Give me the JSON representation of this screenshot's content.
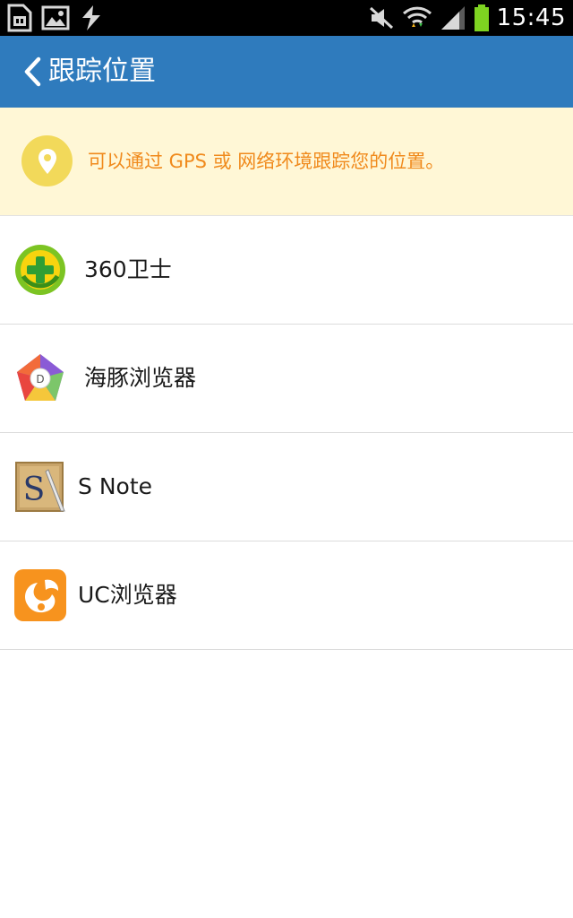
{
  "status_bar": {
    "time": "15:45",
    "icons": [
      "sim-card-icon",
      "image-notification-icon",
      "usb-debug-icon",
      "mute-icon",
      "wifi-icon",
      "signal-icon",
      "battery-icon"
    ]
  },
  "app_bar": {
    "title": "跟踪位置",
    "back_icon": "chevron-left-icon",
    "color": "#2f7bbd"
  },
  "banner": {
    "text": "可以通过 GPS 或 网络环境跟踪您的位置。",
    "icon": "location-pin-icon",
    "text_color": "#f08a1c",
    "background": "#fff7d6"
  },
  "apps": [
    {
      "label": "360卫士",
      "icon": "360-security-icon"
    },
    {
      "label": "海豚浏览器",
      "icon": "dolphin-browser-icon"
    },
    {
      "label": "S Note",
      "icon": "s-note-icon"
    },
    {
      "label": "UC浏览器",
      "icon": "uc-browser-icon"
    }
  ]
}
